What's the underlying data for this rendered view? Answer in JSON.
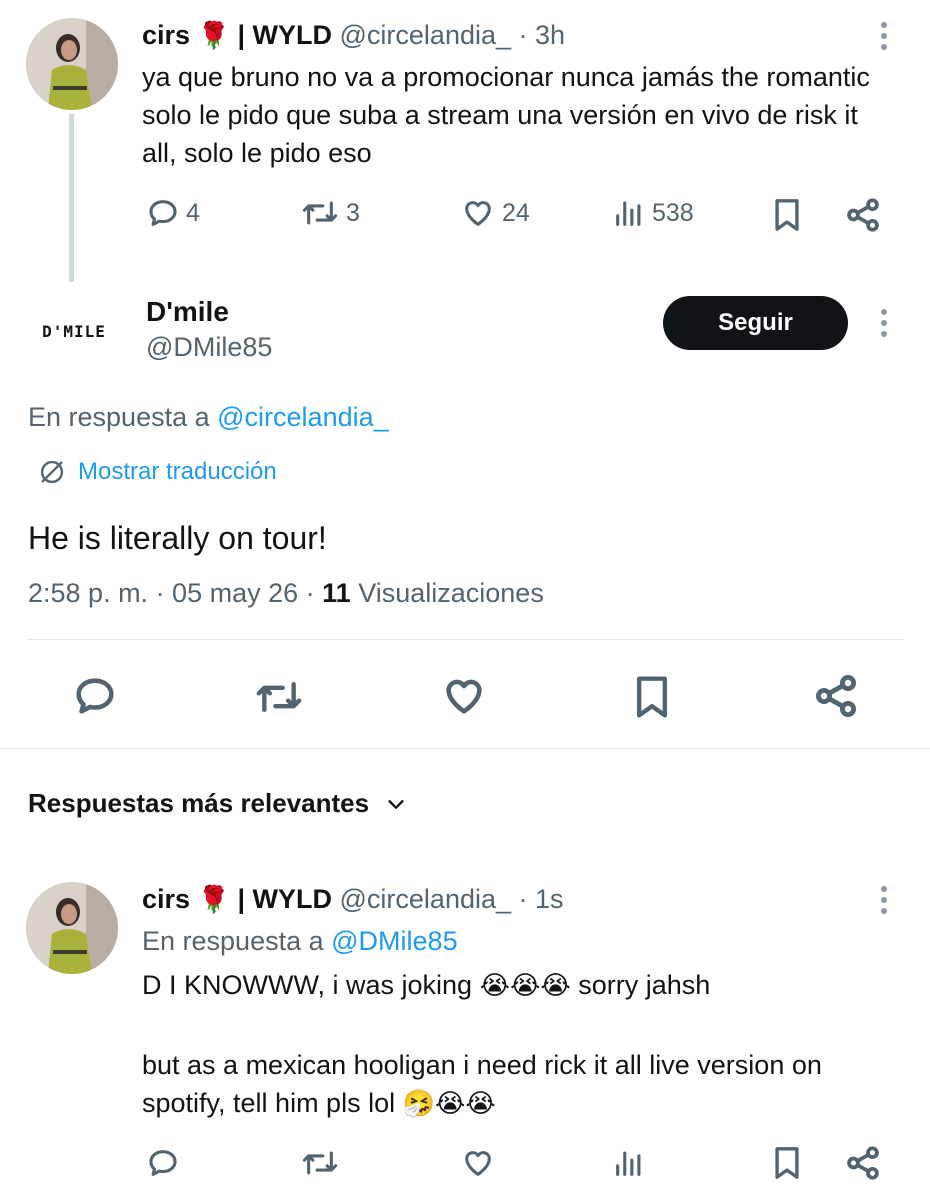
{
  "tweet1": {
    "display_name": "cirs",
    "rose_emoji": "🌹",
    "name_suffix": "| WYLD",
    "handle": "@circelandia_",
    "time": "· 3h",
    "text": "ya que bruno no va a promocionar nunca jamás the romantic solo le pido que suba a stream una versión en vivo de risk it all, solo le pido eso",
    "replies": "4",
    "retweets": "3",
    "likes": "24",
    "views": "538"
  },
  "main_tweet": {
    "display_name": "D'mile",
    "handle": "@DMile85",
    "logo_text": "D'MILE",
    "follow_label": "Seguir",
    "reply_prefix": "En respuesta a",
    "reply_to": "@circelandia_",
    "translate_label": "Mostrar traducción",
    "text": "He is literally on tour!",
    "timestamp": "2:58 p. m. · 05 may 26 ·",
    "views_count": "11",
    "views_label": "Visualizaciones"
  },
  "replies_section": {
    "sort_label": "Respuestas más relevantes"
  },
  "reply1": {
    "display_name": "cirs",
    "rose_emoji": "🌹",
    "name_suffix": "| WYLD",
    "handle": "@circelandia_",
    "time": "· 1s",
    "reply_prefix": "En respuesta a",
    "reply_to": "@DMile85",
    "line1_text": "D I KNOWWW, i was joking",
    "line1_emojis": "😭😭😭",
    "line1_end": "sorry jahsh",
    "line2_text": "but as a mexican hooligan i need rick it all live version on spotify, tell him pls lol",
    "line2_emojis": "🤧😭😭"
  },
  "colors": {
    "text": "#0f1419",
    "muted": "#536471",
    "link": "#1d9bf0",
    "button": "#0f1419",
    "divider": "#eff3f4"
  }
}
